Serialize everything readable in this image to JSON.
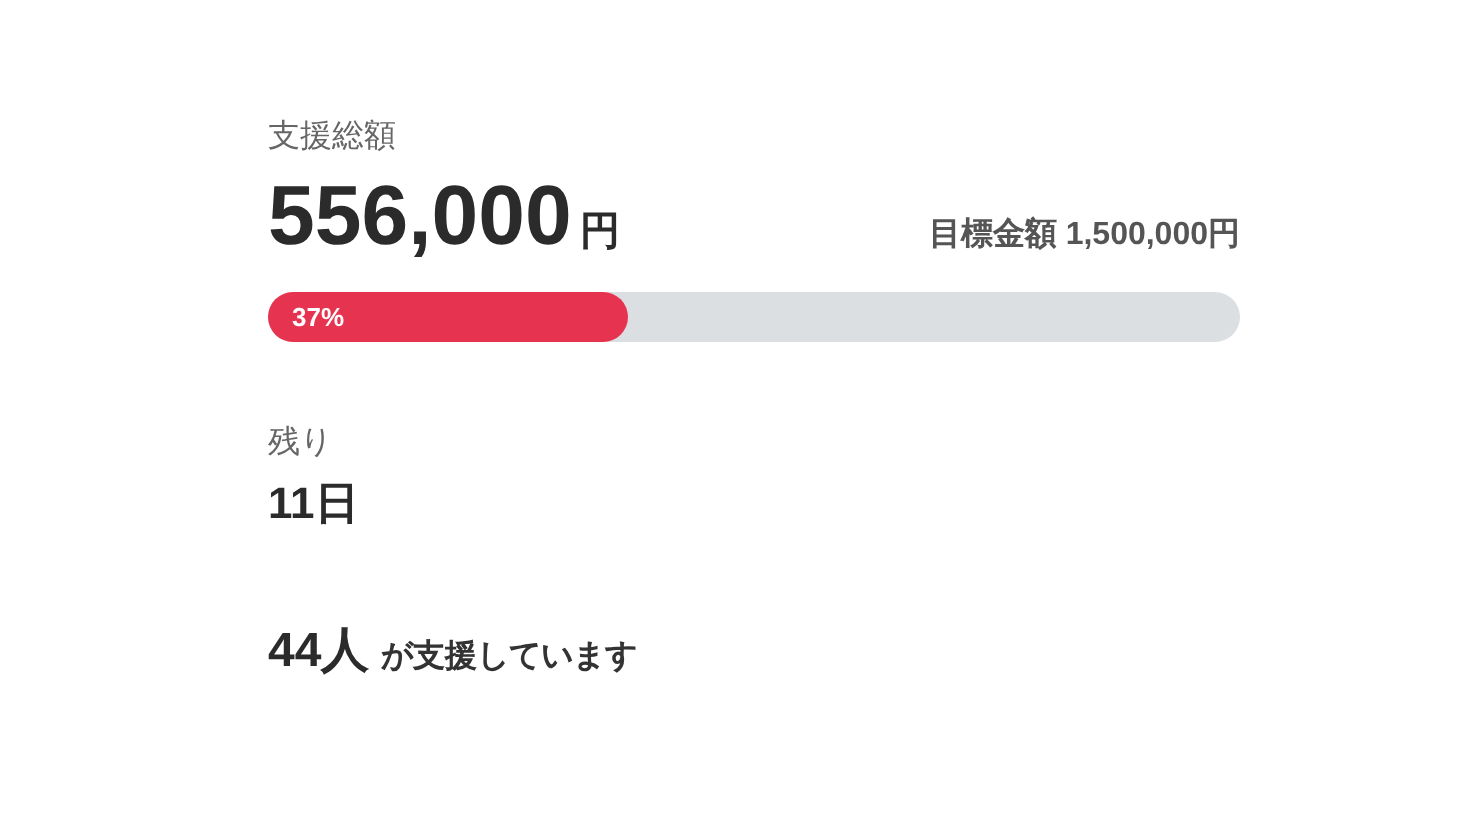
{
  "total": {
    "label": "支援総額",
    "amount": "556,000",
    "unit": "円",
    "goal": "目標金額 1,500,000円"
  },
  "progress": {
    "level": 0.37,
    "label": "37%"
  },
  "remaining": {
    "label": "残り",
    "value": "11日"
  },
  "supporters": {
    "count": "44人",
    "text": "が支援しています"
  }
}
